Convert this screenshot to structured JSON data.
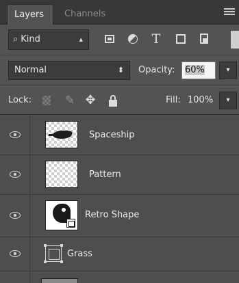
{
  "tabs": [
    {
      "label": "Layers",
      "active": true
    },
    {
      "label": "Channels",
      "active": false
    }
  ],
  "filter": {
    "kind_label": "Kind",
    "icons": [
      "pixel-layer-filter-icon",
      "adjustment-layer-filter-icon",
      "type-layer-filter-icon",
      "shape-layer-filter-icon",
      "smart-object-filter-icon"
    ],
    "type_glyph": "T"
  },
  "blend": {
    "mode": "Normal",
    "opacity_label": "Opacity:",
    "opacity_value": "60%"
  },
  "lock": {
    "label": "Lock:",
    "fill_label": "Fill:",
    "fill_value": "100%"
  },
  "layers": [
    {
      "name": "Spaceship",
      "visible": true,
      "thumbnail": "spaceship"
    },
    {
      "name": "Pattern",
      "visible": true,
      "thumbnail": "transparent"
    },
    {
      "name": "Retro Shape",
      "visible": true,
      "thumbnail": "vector-shape"
    },
    {
      "name": "Grass",
      "visible": true,
      "thumbnail": "shape-layer-icon"
    },
    {
      "name": "",
      "visible": false,
      "thumbnail": "partial"
    }
  ],
  "colors": {
    "panel_bg": "#535353",
    "tabbar_bg": "#383838",
    "text": "#e6e6e6",
    "inactive_tab_text": "#8a8a8a"
  }
}
